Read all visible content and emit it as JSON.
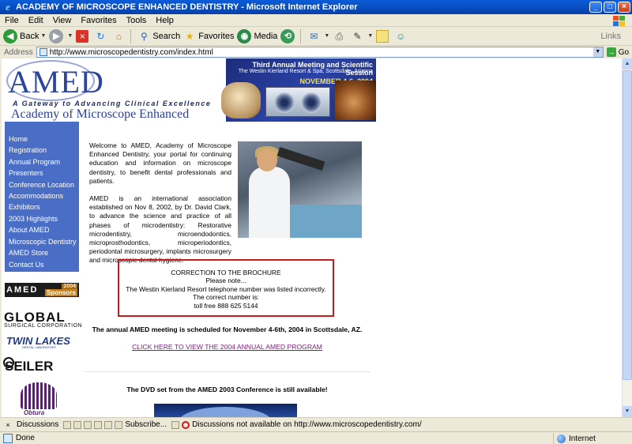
{
  "window": {
    "title": "ACADEMY OF MICROSCOPE ENHANCED DENTISTRY - Microsoft Internet Explorer",
    "min": "_",
    "max": "□",
    "close": "×"
  },
  "menu": [
    "File",
    "Edit",
    "View",
    "Favorites",
    "Tools",
    "Help"
  ],
  "toolbar": {
    "back": "Back",
    "search": "Search",
    "favorites": "Favorites",
    "media": "Media",
    "links": "Links"
  },
  "address": {
    "label": "Address",
    "url": "http://www.microscopedentistry.com/index.html",
    "go": "Go"
  },
  "banner": {
    "logo": "AMED",
    "tagline": "A Gateway to Advancing Clinical Excellence",
    "academy": "Academy of Microscope Enhanced Dentistry",
    "meeting": "Third Annual Meeting and Scientific Session",
    "venue": "The Westin Kierland Resort & Spa, Scottsdale, Arizona",
    "dates": "NOVEMBER 4-6, 2004"
  },
  "nav": [
    "Home",
    "Registration",
    "Annual Program",
    "Presenters",
    "Conference Location",
    "Accommodations",
    "Exhibitors",
    "2003 Highlights",
    "About AMED",
    "Microscopic Dentistry",
    "AMED Store",
    "Contact Us"
  ],
  "sponsors": {
    "label": "AMED",
    "year": "2004",
    "word": "Sponsors",
    "global": "GLOBAL",
    "global_sub": "SURGICAL CORPORATION",
    "twin": "TWIN LAKES",
    "twin_sub": "DENTAL LABORATORY",
    "seiler": "SEILER",
    "orbit": "Obtura"
  },
  "content": {
    "intro1": "Welcome to AMED, Academy of Microscope Enhanced Dentistry, your portal for continuing education and information on microscope dentistry, to benefit dental professionals and patients.",
    "intro2": "AMED is an international association established on Nov 8, 2002, by Dr. David Clark, to advance the science and practice of all phases of microdentistry: Restorative microdentistry, microendodontics, microprosthodontics, microperiodontics, periodontal microsurgery, implants microsurgery and microscopic dental hygiene.",
    "correction_title": "CORRECTION TO THE BROCHURE",
    "correction_note": "Please note...",
    "correction_line1": "The Westin Kierland Resort telephone number was listed incorrectly.",
    "correction_line2": "The correct number is:",
    "correction_phone": "toll free 888 625 5144",
    "announce": "The annual AMED meeting is scheduled for November 4-6th, 2004 in Scottsdale, AZ.",
    "program_link": "CLICK HERE TO VIEW THE 2004 ANNUAL AMED PROGRAM",
    "dvd": "The DVD set from the AMED 2003 Conference is still available!"
  },
  "discuss": {
    "discussions": "Discussions",
    "subscribe": "Subscribe...",
    "notice": "Discussions not available on http://www.microscopedentistry.com/"
  },
  "status": {
    "text": "Done",
    "zone": "Internet"
  }
}
